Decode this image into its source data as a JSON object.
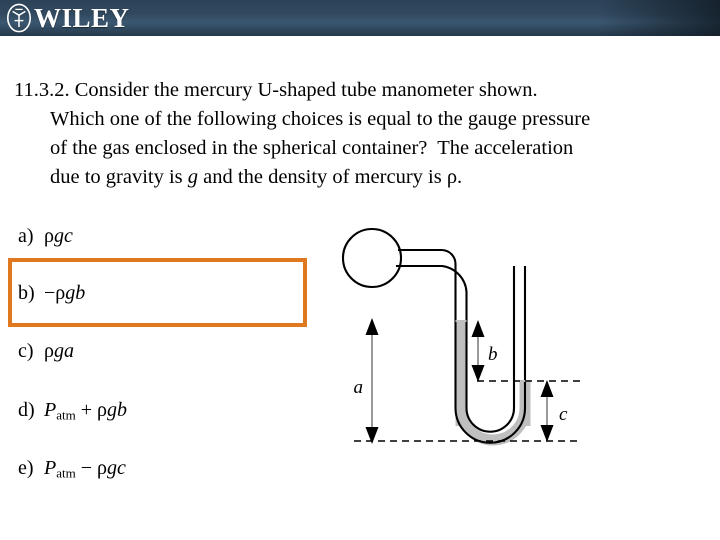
{
  "header": {
    "brand": "WILEY",
    "emblem_icon": "wiley-crest-icon",
    "background_color": "#31495f"
  },
  "question": {
    "number": "11.3.2.",
    "lines": [
      "11.3.2. Consider the mercury U-shaped tube manometer shown.",
      "Which one of the following choices is equal to the gauge pressure",
      "of the gas enclosed in the spherical container?  The acceleration",
      "due to gravity is g and the density of mercury is ρ."
    ],
    "line1": "11.3.2. Consider the mercury U-shaped tube manometer shown.",
    "line2": "Which one of the following choices is equal to the gauge pressure",
    "line3": "of the gas enclosed in the spherical container?  The acceleration",
    "line4_pre": "due to gravity is ",
    "line4_var1": "g",
    "line4_mid": " and the density of mercury is ρ."
  },
  "choices": [
    {
      "label": "a)",
      "text": "ρgc",
      "rho": "ρ",
      "g": "g",
      "var": "c",
      "sign": "",
      "highlighted": false
    },
    {
      "label": "b)",
      "text": "−ρgb",
      "rho": "ρ",
      "g": "g",
      "var": "b",
      "sign": "−",
      "highlighted": true
    },
    {
      "label": "c)",
      "text": "ρga",
      "rho": "ρ",
      "g": "g",
      "var": "a",
      "sign": "",
      "highlighted": false
    },
    {
      "label": "d)",
      "text": "Patm + ρgb",
      "rho": "ρ",
      "g": "g",
      "var": "b",
      "sign": "+",
      "base": "P",
      "subscript": "atm",
      "highlighted": false
    },
    {
      "label": "e)",
      "text": "Patm − ρgc",
      "rho": "ρ",
      "g": "g",
      "var": "c",
      "sign": "−",
      "base": "P",
      "subscript": "atm",
      "highlighted": false
    }
  ],
  "highlight": {
    "answer": "b",
    "border_color": "#e0781f"
  },
  "figure": {
    "name": "mercury-u-tube-manometer",
    "mercury_color": "#bfbfbf",
    "outline_color": "#000000",
    "labels": {
      "a": "a",
      "b": "b",
      "c": "c"
    },
    "parts": {
      "sphere": "spherical-gas-container",
      "connecting_tube": "connecting-tube",
      "left_tube": "left-vertical-tube",
      "right_tube": "right-open-tube",
      "u_bend": "u-bend",
      "mercury": "mercury-column"
    }
  }
}
